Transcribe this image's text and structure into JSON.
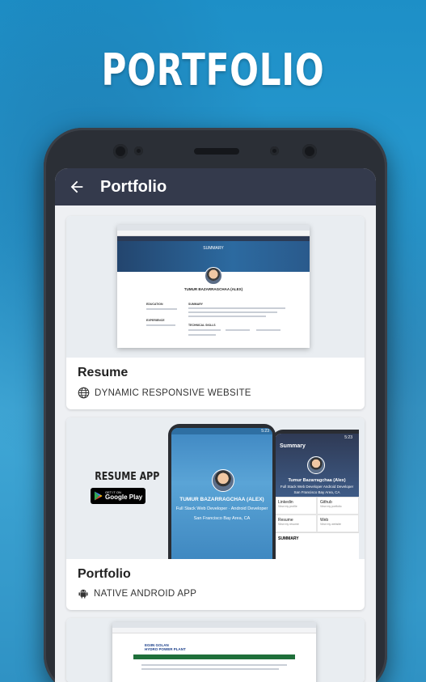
{
  "headline": "PORTFOLIO",
  "appbar": {
    "title": "Portfolio",
    "back_icon": "arrow-back-icon"
  },
  "cards": [
    {
      "title": "Resume",
      "subtitle": "DYNAMIC RESPONSIVE WEBSITE",
      "icon": "globe-icon",
      "mockup": {
        "hero_heading": "SUMMARY",
        "name": "TUMUR BAZARRAGCHAA (ALEX)",
        "sections": [
          "EDUCATION",
          "EXPERIENCE",
          "SUMMARY",
          "TECHNICAL SKILLS"
        ]
      }
    },
    {
      "title": "Portfolio",
      "subtitle": "NATIVE ANDROID APP",
      "icon": "android-icon",
      "promo": {
        "title": "RESUME APP",
        "badge_small": "GET IT ON",
        "badge_big": "Google Play"
      },
      "phone_front": {
        "time": "5:23",
        "name": "TUMUR BAZARRAGCHAA (ALEX)",
        "role": "Full Stack Web Developer  ·  Android Developer",
        "location": "San Francisco Bay Area, CA"
      },
      "phone_back": {
        "time": "5:23",
        "title": "Summary",
        "name": "Tumur Bazarragchaa (Alex)",
        "role": "Full Stack Web Developer  Android Developer",
        "location": "San Francisco Bay Area, CA",
        "links": [
          {
            "label": "Linkedin",
            "sub": "View my profile"
          },
          {
            "label": "Github",
            "sub": "View my portfolio"
          },
          {
            "label": "Resume",
            "sub": "View my resume"
          },
          {
            "label": "Web",
            "sub": "View my website"
          }
        ],
        "summary_heading": "SUMMARY"
      }
    },
    {
      "mockup": {
        "logo_line1": "EGIIN GOLAN",
        "logo_line2": "HYDRO POWER PLANT"
      }
    }
  ],
  "colors": {
    "background": "#2a9bd0",
    "appbar": "#343a4c",
    "card": "#ffffff"
  }
}
